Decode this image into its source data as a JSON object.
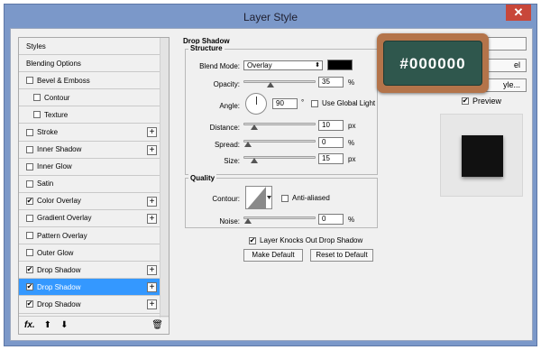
{
  "window": {
    "title": "Layer Style",
    "close": "✕"
  },
  "sidebar": {
    "items": [
      {
        "label": "Styles",
        "checkbox": false,
        "checked": false,
        "plus": false,
        "indent": 0,
        "selected": false
      },
      {
        "label": "Blending Options",
        "checkbox": false,
        "checked": false,
        "plus": false,
        "indent": 0,
        "selected": false
      },
      {
        "label": "Bevel & Emboss",
        "checkbox": true,
        "checked": false,
        "plus": false,
        "indent": 0,
        "selected": false
      },
      {
        "label": "Contour",
        "checkbox": true,
        "checked": false,
        "plus": false,
        "indent": 1,
        "selected": false
      },
      {
        "label": "Texture",
        "checkbox": true,
        "checked": false,
        "plus": false,
        "indent": 1,
        "selected": false
      },
      {
        "label": "Stroke",
        "checkbox": true,
        "checked": false,
        "plus": true,
        "indent": 0,
        "selected": false
      },
      {
        "label": "Inner Shadow",
        "checkbox": true,
        "checked": false,
        "plus": true,
        "indent": 0,
        "selected": false
      },
      {
        "label": "Inner Glow",
        "checkbox": true,
        "checked": false,
        "plus": false,
        "indent": 0,
        "selected": false
      },
      {
        "label": "Satin",
        "checkbox": true,
        "checked": false,
        "plus": false,
        "indent": 0,
        "selected": false
      },
      {
        "label": "Color Overlay",
        "checkbox": true,
        "checked": true,
        "plus": true,
        "indent": 0,
        "selected": false
      },
      {
        "label": "Gradient Overlay",
        "checkbox": true,
        "checked": false,
        "plus": true,
        "indent": 0,
        "selected": false
      },
      {
        "label": "Pattern Overlay",
        "checkbox": true,
        "checked": false,
        "plus": false,
        "indent": 0,
        "selected": false
      },
      {
        "label": "Outer Glow",
        "checkbox": true,
        "checked": false,
        "plus": false,
        "indent": 0,
        "selected": false
      },
      {
        "label": "Drop Shadow",
        "checkbox": true,
        "checked": true,
        "plus": true,
        "indent": 0,
        "selected": false
      },
      {
        "label": "Drop Shadow",
        "checkbox": true,
        "checked": true,
        "plus": true,
        "indent": 0,
        "selected": true
      },
      {
        "label": "Drop Shadow",
        "checkbox": true,
        "checked": true,
        "plus": true,
        "indent": 0,
        "selected": false
      }
    ],
    "footer": {
      "fx": "fx.",
      "up": "⬆",
      "down": "⬇",
      "trash": "🗑"
    }
  },
  "drop_shadow": {
    "title": "Drop Shadow",
    "structure_title": "Structure",
    "blend_mode_label": "Blend Mode:",
    "blend_mode_value": "Overlay",
    "blend_color": "#000000",
    "opacity_label": "Opacity:",
    "opacity_value": "35",
    "opacity_unit": "%",
    "opacity_level": 0.35,
    "angle_label": "Angle:",
    "angle_value": "90",
    "angle_unit": "°",
    "global_light_label": "Use Global Light",
    "distance_label": "Distance:",
    "distance_value": "10",
    "distance_unit": "px",
    "distance_level": 0.1,
    "spread_label": "Spread:",
    "spread_value": "0",
    "spread_unit": "%",
    "spread_level": 0,
    "size_label": "Size:",
    "size_value": "15",
    "size_unit": "px",
    "size_level": 0.1,
    "quality_title": "Quality",
    "contour_label": "Contour:",
    "anti_aliased_label": "Anti-aliased",
    "noise_label": "Noise:",
    "noise_value": "0",
    "noise_unit": "%",
    "noise_level": 0,
    "knocks_out_label": "Layer Knocks Out Drop Shadow",
    "knocks_out_checked": true,
    "make_default": "Make Default",
    "reset_default": "Reset to Default"
  },
  "right": {
    "cancel_visible": "el",
    "new_style_visible": "yle...",
    "preview_label": "Preview",
    "preview_checked": true
  },
  "badge": {
    "text": "#000000"
  }
}
